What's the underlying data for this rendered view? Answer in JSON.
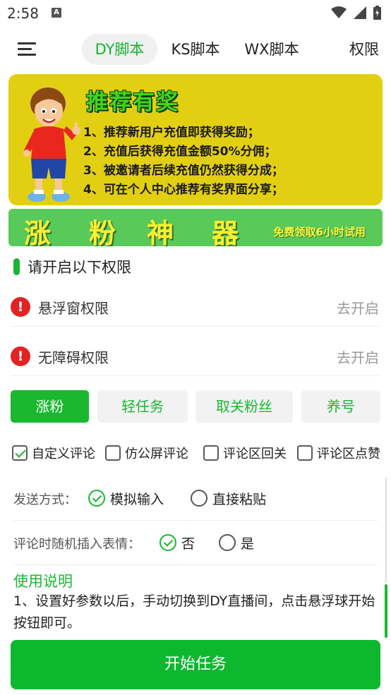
{
  "status_bar": {
    "time": "2:58",
    "notification_icon": "a-notification-icon",
    "icons": [
      "wifi-icon",
      "signal-icon",
      "battery-icon"
    ]
  },
  "nav": {
    "menu_icon": "hamburger-menu-icon",
    "tabs": [
      {
        "label": "DY脚本",
        "active": true
      },
      {
        "label": "KS脚本",
        "active": false
      },
      {
        "label": "WX脚本",
        "active": false
      },
      {
        "label": "权限",
        "active": false
      }
    ]
  },
  "banner": {
    "title": "推荐有奖",
    "lines": [
      "1、推荐新用户充值即获得奖励；",
      "2、充值后获得充值金额50%分佣；",
      "3、被邀请者后续充值仍然获得分成；",
      "4、可在个人中心推荐有奖界面分享；"
    ],
    "colors": {
      "background": "#e3cf12",
      "title": "#43d61e"
    }
  },
  "promo": {
    "chars": [
      "涨",
      "粉",
      "神",
      "器"
    ],
    "subtitle": "免费领取6小时试用",
    "colors": {
      "background": "#59c95a",
      "text": "#ffef2d"
    }
  },
  "permissions": {
    "heading": "请开启以下权限",
    "items": [
      {
        "label": "悬浮窗权限",
        "action": "去开启",
        "icon": "error-exclamation-icon"
      },
      {
        "label": "无障碍权限",
        "action": "去开启",
        "icon": "error-exclamation-icon"
      }
    ]
  },
  "modes": [
    {
      "label": "涨粉",
      "active": true
    },
    {
      "label": "轻任务",
      "active": false
    },
    {
      "label": "取关粉丝",
      "active": false
    },
    {
      "label": "养号",
      "active": false
    }
  ],
  "options": [
    {
      "label": "自定义评论",
      "checked": true
    },
    {
      "label": "仿公屏评论",
      "checked": false
    },
    {
      "label": "评论区回关",
      "checked": false
    },
    {
      "label": "评论区点赞",
      "checked": false
    }
  ],
  "send_method": {
    "label": "发送方式：",
    "choices": [
      {
        "label": "模拟输入",
        "selected": true
      },
      {
        "label": "直接粘贴",
        "selected": false
      }
    ]
  },
  "emoji_insert": {
    "label": "评论时随机插入表情：",
    "choices": [
      {
        "label": "否",
        "selected": true
      },
      {
        "label": "是",
        "selected": false
      }
    ]
  },
  "usage": {
    "title": "使用说明",
    "text": "1、设置好参数以后，手动切换到DY直播间，点击悬浮球开始按钮即可。"
  },
  "start_button": {
    "label": "开始任务"
  },
  "accent_color": "#19b82f"
}
